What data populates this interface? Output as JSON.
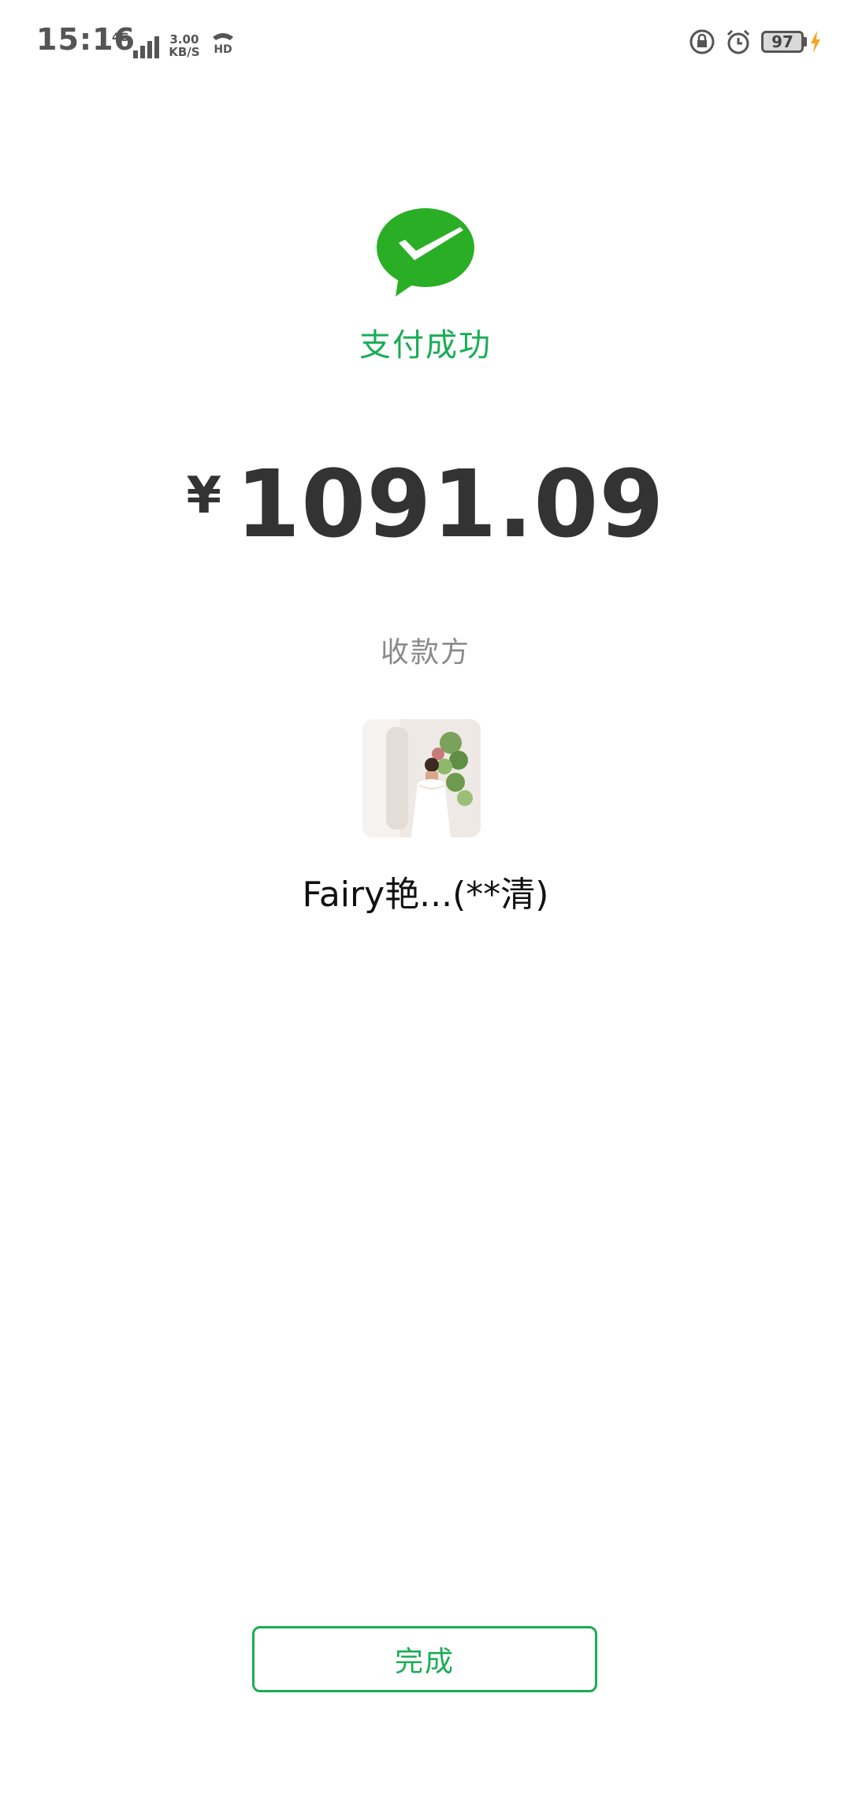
{
  "status_bar": {
    "time": "15:16",
    "network_type": "4G",
    "speed_value": "3.00",
    "speed_unit": "KB/S",
    "hd_label": "HD",
    "battery_level": "97",
    "icons": [
      "signal-icon",
      "hd-call-icon",
      "lock-rotation-icon",
      "alarm-icon",
      "battery-icon",
      "charging-icon"
    ]
  },
  "payment": {
    "status_title": "支付成功",
    "currency_symbol": "¥",
    "amount": "1091.09",
    "payee_label": "收款方",
    "payee_name": "Fairy艳...(**清)"
  },
  "actions": {
    "done_label": "完成"
  },
  "colors": {
    "brand_green": "#1aad55",
    "wechat_logo_green": "#2aae25",
    "amount_text": "#333333",
    "secondary_text": "#8a8a8a"
  }
}
